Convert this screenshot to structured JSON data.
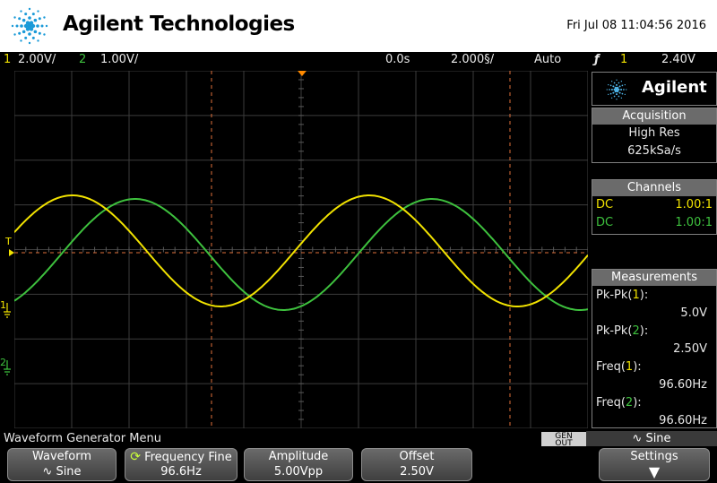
{
  "header": {
    "brand": "Agilent Technologies",
    "datetime": "Fri Jul 08 11:04:56 2016"
  },
  "status": {
    "ch1_num": "1",
    "ch1_scale": "2.00V/",
    "ch2_num": "2",
    "ch2_scale": "1.00V/",
    "time_offset": "0.0s",
    "time_scale": "2.000§/",
    "trigger_mode": "Auto",
    "trigger_icon": "ƒ",
    "trigger_channel": "1",
    "trigger_level": "2.40V"
  },
  "markers": {
    "trigger": "T",
    "ch1": "1",
    "ch2": "2"
  },
  "panel": {
    "brand": "Agilent",
    "acquisition": {
      "title": "Acquisition",
      "mode": "High Res",
      "rate": "625kSa/s"
    },
    "channels": {
      "title": "Channels",
      "rows": [
        {
          "coupling": "DC",
          "ratio": "1.00:1",
          "color": "#f1e200"
        },
        {
          "coupling": "DC",
          "ratio": "1.00:1",
          "color": "#3ec13e"
        }
      ]
    },
    "measurements": {
      "title": "Measurements",
      "items": [
        {
          "pre": "Pk-Pk(",
          "ch": "1",
          "post": "):",
          "value": "5.0V",
          "color": "#f1e200"
        },
        {
          "pre": "Pk-Pk(",
          "ch": "2",
          "post": "):",
          "value": "2.50V",
          "color": "#3ec13e"
        },
        {
          "pre": "Freq(",
          "ch": "1",
          "post": "):",
          "value": "96.60Hz",
          "color": "#f1e200"
        },
        {
          "pre": "Freq(",
          "ch": "2",
          "post": "):",
          "value": "96.60Hz",
          "color": "#3ec13e"
        }
      ]
    }
  },
  "menu": {
    "title": "Waveform Generator Menu",
    "gen_out_line1": "GEN",
    "gen_out_line2": "OUT",
    "indicator": "∿ Sine",
    "keys": [
      {
        "label": "Waveform",
        "value": "∿ Sine"
      },
      {
        "label": "Frequency Fine",
        "value": "96.6Hz"
      },
      {
        "label": "Amplitude",
        "value": "5.00Vpp"
      },
      {
        "label": "Offset",
        "value": "2.50V"
      },
      {
        "label": "Settings",
        "value": "▼"
      }
    ]
  },
  "colors": {
    "ch1": "#f1e200",
    "ch2": "#3ec13e",
    "grid": "#3c3c3c",
    "cursor": "#e0703a",
    "trigger_arrow": "#ff8a00"
  },
  "trace_data": {
    "ch1": {
      "frequency_hz": 96.6,
      "pk_pk_v": 5.0
    },
    "ch2": {
      "frequency_hz": 96.6,
      "pk_pk_v": 2.5
    }
  }
}
